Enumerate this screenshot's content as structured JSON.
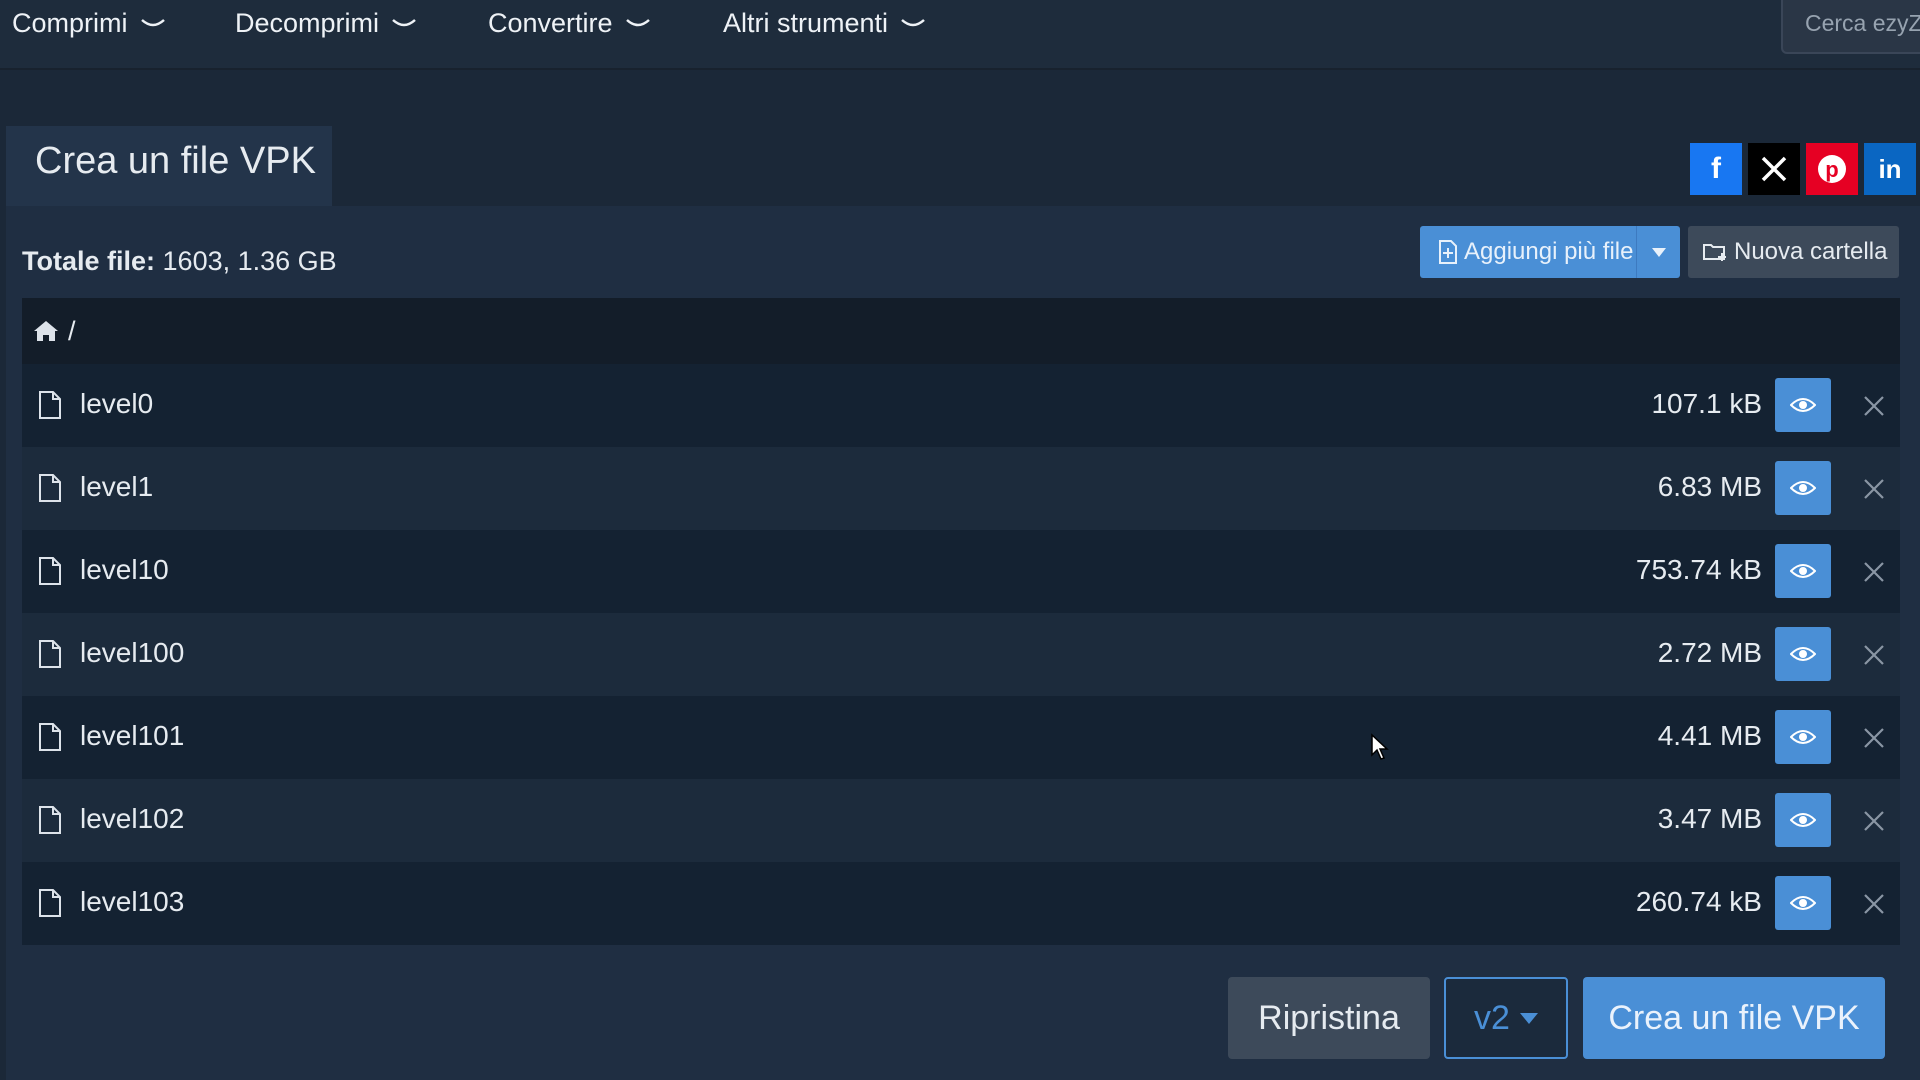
{
  "nav": {
    "items": [
      {
        "label": "Comprimi"
      },
      {
        "label": "Decomprimi"
      },
      {
        "label": "Convertire"
      },
      {
        "label": "Altri strumenti"
      }
    ],
    "search_placeholder": "Cerca ezyZip"
  },
  "tab": {
    "title": "Crea un file VPK"
  },
  "social": {
    "facebook": {
      "label": "f",
      "color": "#1877f2"
    },
    "x": {
      "label": "X",
      "color": "#000000"
    },
    "pinterest": {
      "label": "P",
      "color": "#e60023"
    },
    "linkedin": {
      "label": "in",
      "color": "#0a66c2"
    }
  },
  "totals": {
    "label": "Totale file:",
    "value": "1603, 1.36 GB"
  },
  "toolbar": {
    "add_files": "Aggiungi più file",
    "new_folder": "Nuova cartella"
  },
  "breadcrumb": {
    "path": "/"
  },
  "files": [
    {
      "name": "level0",
      "size": "107.1 kB"
    },
    {
      "name": "level1",
      "size": "6.83 MB"
    },
    {
      "name": "level10",
      "size": "753.74 kB"
    },
    {
      "name": "level100",
      "size": "2.72 MB"
    },
    {
      "name": "level101",
      "size": "4.41 MB"
    },
    {
      "name": "level102",
      "size": "3.47 MB"
    },
    {
      "name": "level103",
      "size": "260.74 kB"
    }
  ],
  "actions": {
    "reset": "Ripristina",
    "version": "v2",
    "create": "Crea un file VPK"
  },
  "colors": {
    "accent": "#4a8fd6",
    "background": "#1b2838",
    "panel": "#1f2e42"
  }
}
